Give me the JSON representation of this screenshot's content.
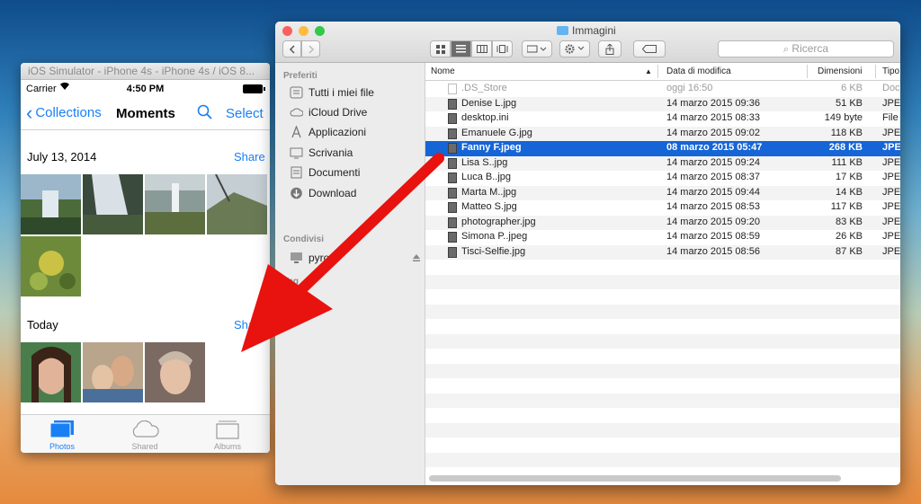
{
  "simulator": {
    "title": "iOS Simulator - iPhone 4s - iPhone 4s / iOS 8...",
    "status": {
      "carrier": "Carrier",
      "time": "4:50 PM"
    },
    "nav": {
      "back_label": "Collections",
      "title": "Moments",
      "select_label": "Select"
    },
    "sections": [
      {
        "date": "July 13, 2014",
        "share": "Share"
      },
      {
        "date": "Today",
        "share": "Share"
      }
    ],
    "tabs": [
      {
        "label": "Photos"
      },
      {
        "label": "Shared"
      },
      {
        "label": "Albums"
      }
    ]
  },
  "finder": {
    "title": "Immagini",
    "search_placeholder": "Ricerca",
    "sidebar": {
      "favorites_header": "Preferiti",
      "favorites": [
        {
          "label": "Tutti i miei file",
          "icon": "all-files-icon"
        },
        {
          "label": "iCloud Drive",
          "icon": "cloud-icon"
        },
        {
          "label": "Applicazioni",
          "icon": "applications-icon"
        },
        {
          "label": "Scrivania",
          "icon": "desktop-icon"
        },
        {
          "label": "Documenti",
          "icon": "documents-icon"
        },
        {
          "label": "Download",
          "icon": "download-icon"
        }
      ],
      "shared_header": "Condivisi",
      "shared": [
        {
          "label": "pyros",
          "icon": "computer-icon"
        }
      ],
      "tags_header": "Tag"
    },
    "columns": {
      "name": "Nome",
      "date": "Data di modifica",
      "size": "Dimensioni",
      "kind": "Tipo"
    },
    "rows": [
      {
        "name": ".DS_Store",
        "date": "oggi 16:50",
        "size": "6 KB",
        "kind": "Doc"
      },
      {
        "name": "Denise L.jpg",
        "date": "14 marzo 2015 09:36",
        "size": "51 KB",
        "kind": "JPE"
      },
      {
        "name": "desktop.ini",
        "date": "14 marzo 2015 08:33",
        "size": "149 byte",
        "kind": "File"
      },
      {
        "name": "Emanuele G.jpg",
        "date": "14 marzo 2015 09:02",
        "size": "118 KB",
        "kind": "JPE"
      },
      {
        "name": "Fanny F.jpeg",
        "date": "08 marzo 2015 05:47",
        "size": "268 KB",
        "kind": "JPE"
      },
      {
        "name": "Lisa S..jpg",
        "date": "14 marzo 2015 09:24",
        "size": "111 KB",
        "kind": "JPE"
      },
      {
        "name": "Luca B..jpg",
        "date": "14 marzo 2015 08:37",
        "size": "17 KB",
        "kind": "JPE"
      },
      {
        "name": "Marta M..jpg",
        "date": "14 marzo 2015 09:44",
        "size": "14 KB",
        "kind": "JPE"
      },
      {
        "name": "Matteo S.jpg",
        "date": "14 marzo 2015 08:53",
        "size": "117 KB",
        "kind": "JPE"
      },
      {
        "name": "photographer.jpg",
        "date": "14 marzo 2015 09:20",
        "size": "83 KB",
        "kind": "JPE"
      },
      {
        "name": "Simona P..jpeg",
        "date": "14 marzo 2015 08:59",
        "size": "26 KB",
        "kind": "JPE"
      },
      {
        "name": "Tisci-Selfie.jpg",
        "date": "14 marzo 2015 08:56",
        "size": "87 KB",
        "kind": "JPE"
      }
    ]
  }
}
